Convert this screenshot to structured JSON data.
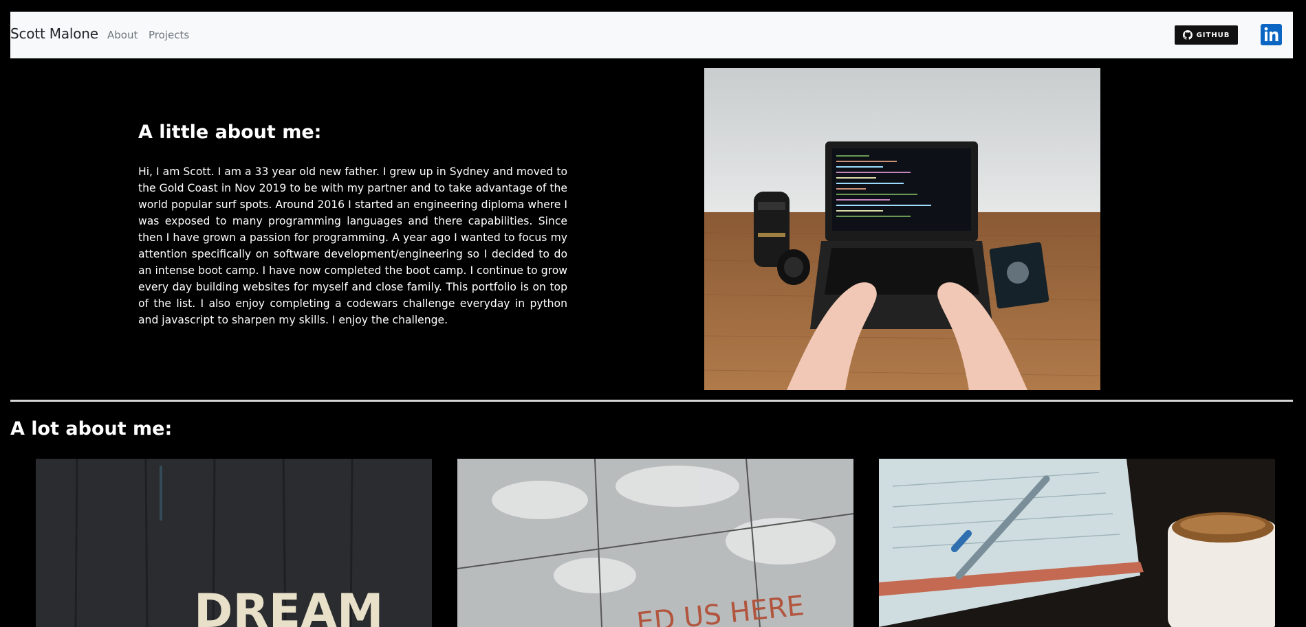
{
  "nav": {
    "brand": "Scott Malone",
    "links": [
      "About",
      "Projects"
    ],
    "github_label": "GITHUB",
    "linkedin_label": "in"
  },
  "about": {
    "title": "A little about me:",
    "text": "Hi, I am Scott. I am a 33 year old new father. I grew up in Sydney and moved to the Gold Coast in Nov 2019 to be with my partner and to take advantage of the world popular surf spots. Around 2016 I started an engineering diploma where I was exposed to many programming languages and there capabilities. Since then I have grown a passion for programming. A year ago I wanted to focus my attention specifically on software development/engineering so I decided to do an intense boot camp. I have now completed the boot camp. I continue to grow every day building websites for myself and close family. This portfolio is on top of the list. I also enjoy completing a codewars challenge everyday in python and javascript to sharpen my skills. I enjoy the challenge."
  },
  "lot": {
    "title": "A lot about me:",
    "cards": [
      {
        "image_text": "DREAM"
      },
      {
        "image_text": "ED US HERE"
      },
      {
        "image_text": ""
      }
    ]
  },
  "colors": {
    "navbar_bg": "#f8f9fa",
    "linkedin_blue": "#0a66c2",
    "page_bg": "#000000"
  }
}
